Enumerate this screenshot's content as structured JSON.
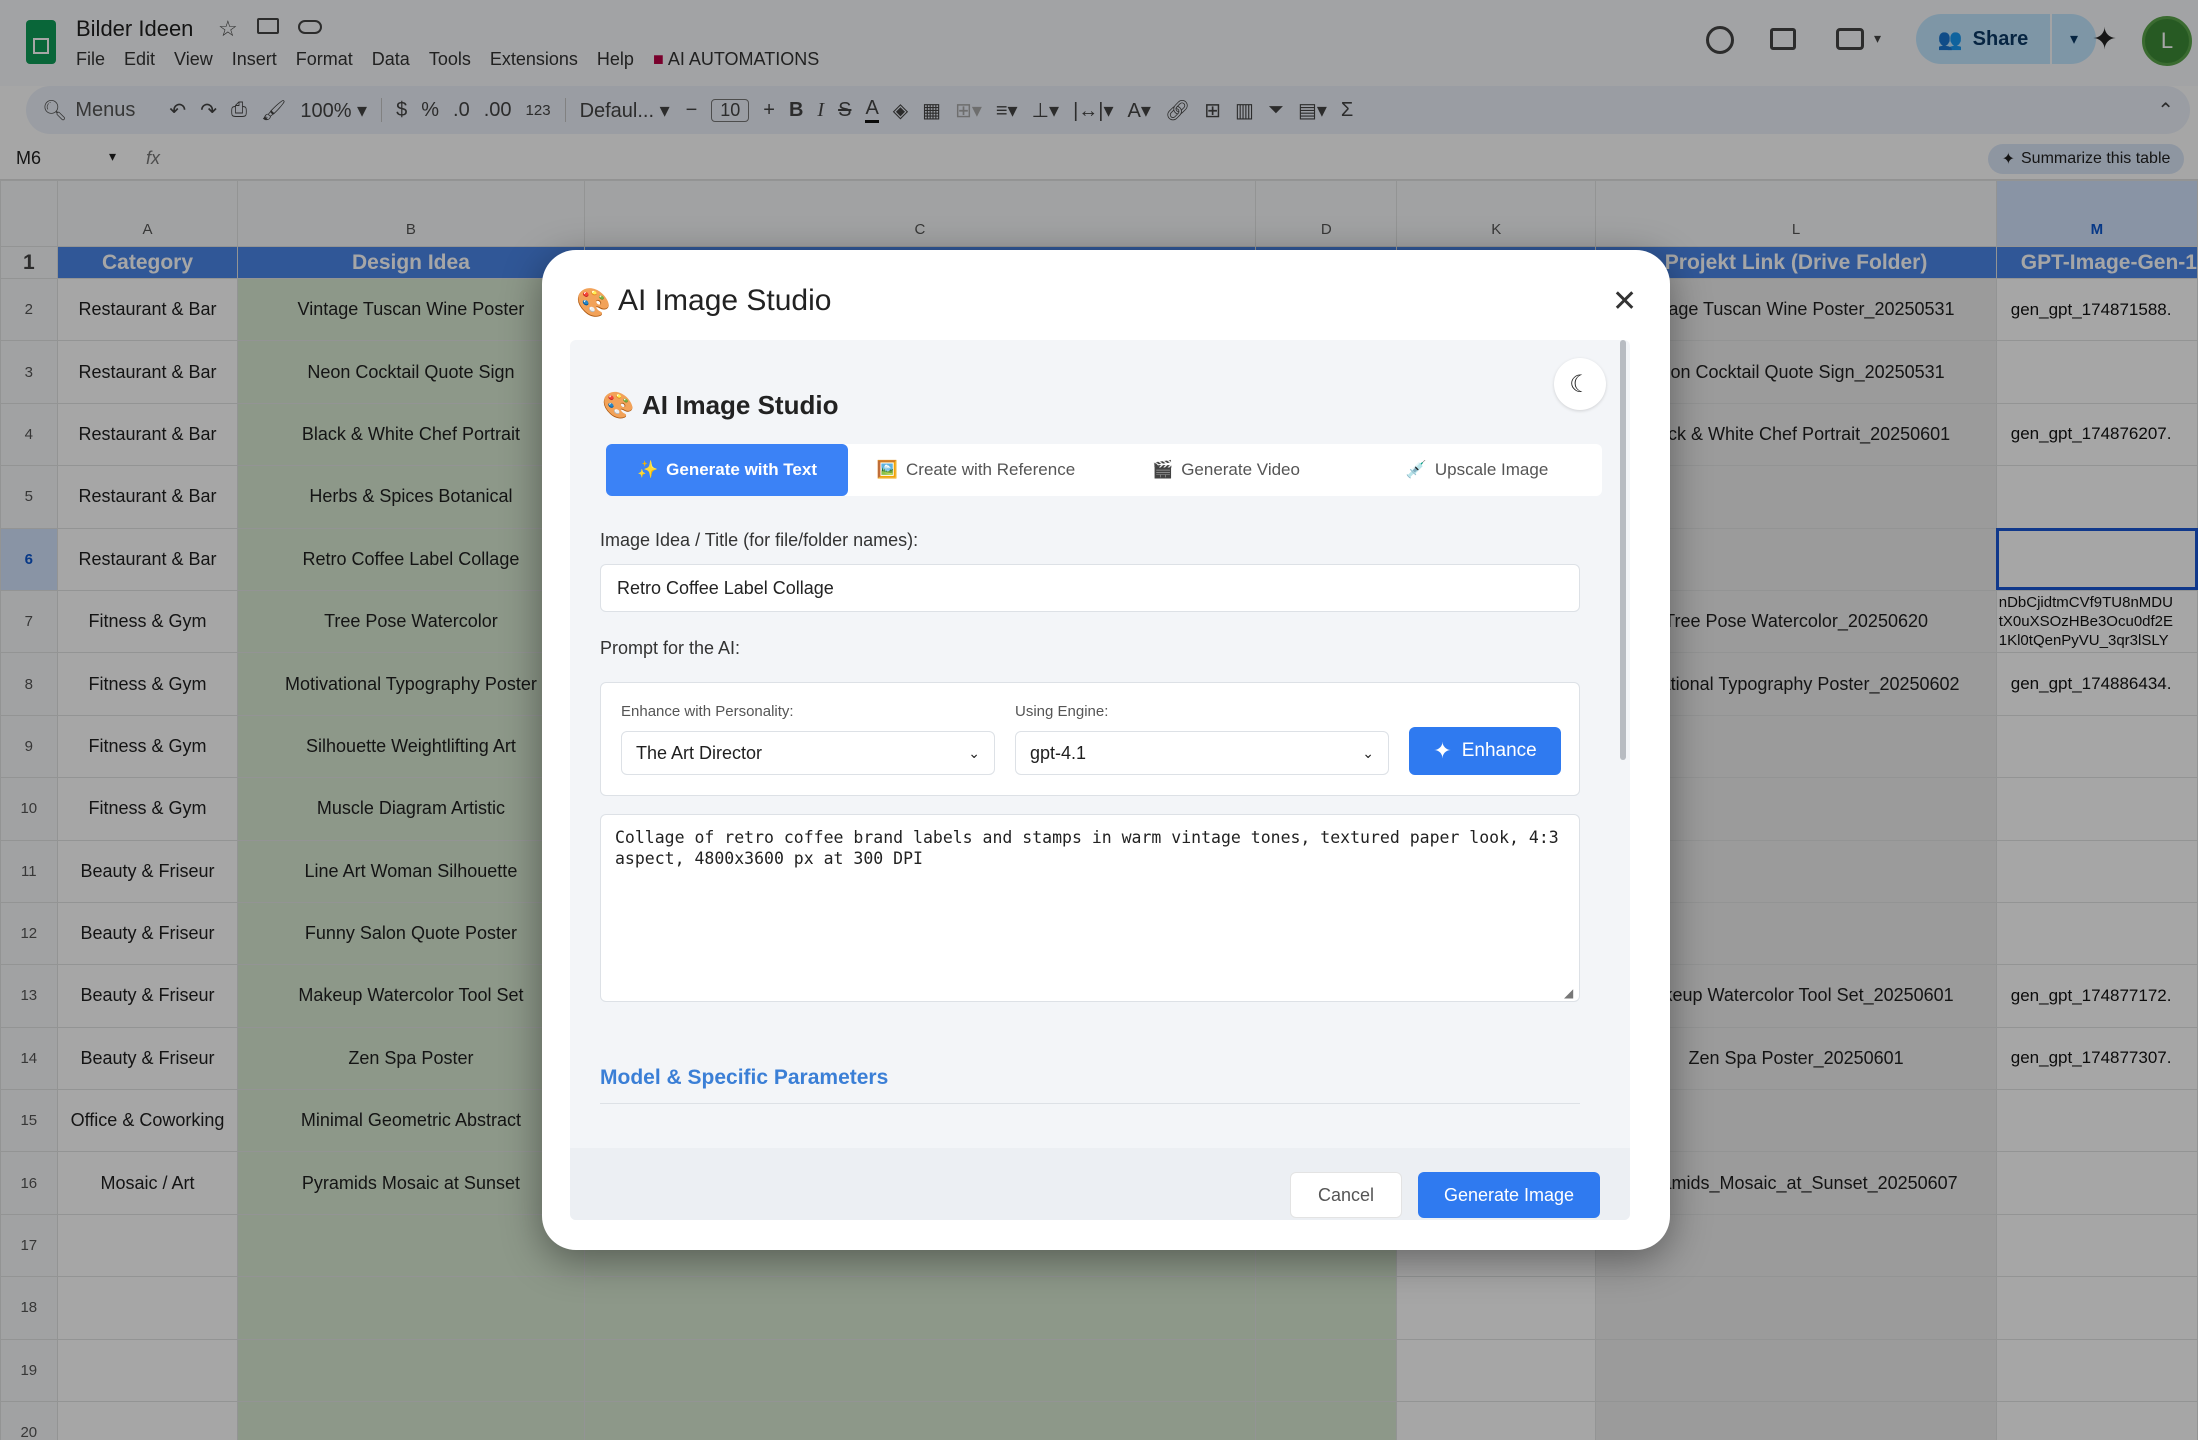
{
  "app": {
    "title": "Bilder Ideen",
    "menus": [
      "File",
      "Edit",
      "View",
      "Insert",
      "Format",
      "Data",
      "Tools",
      "Extensions",
      "Help"
    ],
    "extension_menu": "AI AUTOMATIONS",
    "share_label": "Share",
    "avatar_letter": "L"
  },
  "toolbar": {
    "search_label": "Menus",
    "zoom": "100%",
    "currency": "$",
    "percent": "%",
    "dec_less": ".0",
    "dec_more": ".00",
    "number_format": "123",
    "font": "Defaul...",
    "font_size": "10"
  },
  "formula": {
    "cell_ref": "M6",
    "fx": "fx",
    "summarize_label": "Summarize this table"
  },
  "columns": [
    "A",
    "B",
    "C",
    "D",
    "K",
    "L",
    "M"
  ],
  "header_row": {
    "category": "Category",
    "design_idea": "Design Idea",
    "projekt_link": "Projekt Link (Drive Folder)",
    "gpt_image": "GPT-Image-Gen-1"
  },
  "rows": [
    {
      "n": "2",
      "category": "Restaurant & Bar",
      "idea": "Vintage Tuscan Wine Poster",
      "link": "Vintage Tuscan Wine Poster_20250531",
      "gpt": "gen_gpt_174871588."
    },
    {
      "n": "3",
      "category": "Restaurant & Bar",
      "idea": "Neon Cocktail Quote Sign",
      "link": "Neon Cocktail Quote Sign_20250531",
      "gpt": ""
    },
    {
      "n": "4",
      "category": "Restaurant & Bar",
      "idea": "Black & White Chef Portrait",
      "link": "Black & White Chef Portrait_20250601",
      "gpt": "gen_gpt_174876207."
    },
    {
      "n": "5",
      "category": "Restaurant & Bar",
      "idea": "Herbs & Spices Botanical",
      "link": "",
      "gpt": ""
    },
    {
      "n": "6",
      "category": "Restaurant & Bar",
      "idea": "Retro Coffee Label Collage",
      "link": "",
      "gpt": ""
    },
    {
      "n": "7",
      "category": "Fitness & Gym",
      "idea": "Tree Pose Watercolor",
      "link": "Tree Pose Watercolor_20250620",
      "gpt": "nDbCjidtmCVf9TU8nMDU tX0uXSOzHBe3Ocu0df2E 1Kl0tQenPyVU_3qr3lSLY"
    },
    {
      "n": "8",
      "category": "Fitness & Gym",
      "idea": "Motivational Typography Poster",
      "link": "otivational Typography Poster_20250602",
      "gpt": "gen_gpt_174886434."
    },
    {
      "n": "9",
      "category": "Fitness & Gym",
      "idea": "Silhouette Weightlifting Art",
      "link": "",
      "gpt": ""
    },
    {
      "n": "10",
      "category": "Fitness & Gym",
      "idea": "Muscle Diagram Artistic",
      "link": "",
      "gpt": ""
    },
    {
      "n": "11",
      "category": "Beauty & Friseur",
      "idea": "Line Art Woman Silhouette",
      "link": "",
      "gpt": ""
    },
    {
      "n": "12",
      "category": "Beauty & Friseur",
      "idea": "Funny Salon Quote Poster",
      "link": "",
      "gpt": ""
    },
    {
      "n": "13",
      "category": "Beauty & Friseur",
      "idea": "Makeup Watercolor Tool Set",
      "link": "Makeup Watercolor Tool Set_20250601",
      "gpt": "gen_gpt_174877172."
    },
    {
      "n": "14",
      "category": "Beauty & Friseur",
      "idea": "Zen Spa Poster",
      "link": "Zen Spa Poster_20250601",
      "gpt": "gen_gpt_174877307."
    },
    {
      "n": "15",
      "category": "Office & Coworking",
      "idea": "Minimal Geometric Abstract",
      "link": "",
      "gpt": ""
    },
    {
      "n": "16",
      "category": "Mosaic / Art",
      "idea": "Pyramids Mosaic at Sunset",
      "link": "Pyramids_Mosaic_at_Sunset_20250607",
      "gpt": ""
    },
    {
      "n": "17",
      "category": "",
      "idea": "",
      "link": "",
      "gpt": ""
    },
    {
      "n": "18",
      "category": "",
      "idea": "",
      "link": "",
      "gpt": ""
    },
    {
      "n": "19",
      "category": "",
      "idea": "",
      "link": "",
      "gpt": ""
    },
    {
      "n": "20",
      "category": "",
      "idea": "",
      "link": "",
      "gpt": ""
    }
  ],
  "modal": {
    "title": "AI Image Studio",
    "inner_title": "AI Image Studio",
    "tabs": [
      {
        "label": "Generate with Text",
        "icon": "✨"
      },
      {
        "label": "Create with Reference",
        "icon": "🖼️"
      },
      {
        "label": "Generate Video",
        "icon": "🎬"
      },
      {
        "label": "Upscale Image",
        "icon": "💉"
      }
    ],
    "idea_label": "Image Idea / Title (for file/folder names):",
    "idea_value": "Retro Coffee Label Collage",
    "prompt_label": "Prompt for the AI:",
    "personality_label": "Enhance with Personality:",
    "personality_value": "The Art Director",
    "engine_label": "Using Engine:",
    "engine_value": "gpt-4.1",
    "enhance_label": "Enhance",
    "prompt_text": "Collage of retro coffee brand labels and stamps in warm vintage tones, textured paper look, 4:3 aspect, 4800x3600 px at 300 DPI",
    "params_heading": "Model & Specific Parameters",
    "cancel_label": "Cancel",
    "generate_label": "Generate Image"
  },
  "colors": {
    "header_blue": "#4a86e8",
    "green_col": "#d9ead3",
    "accent": "#2f7af0",
    "share_bg": "#c2e7ff"
  }
}
